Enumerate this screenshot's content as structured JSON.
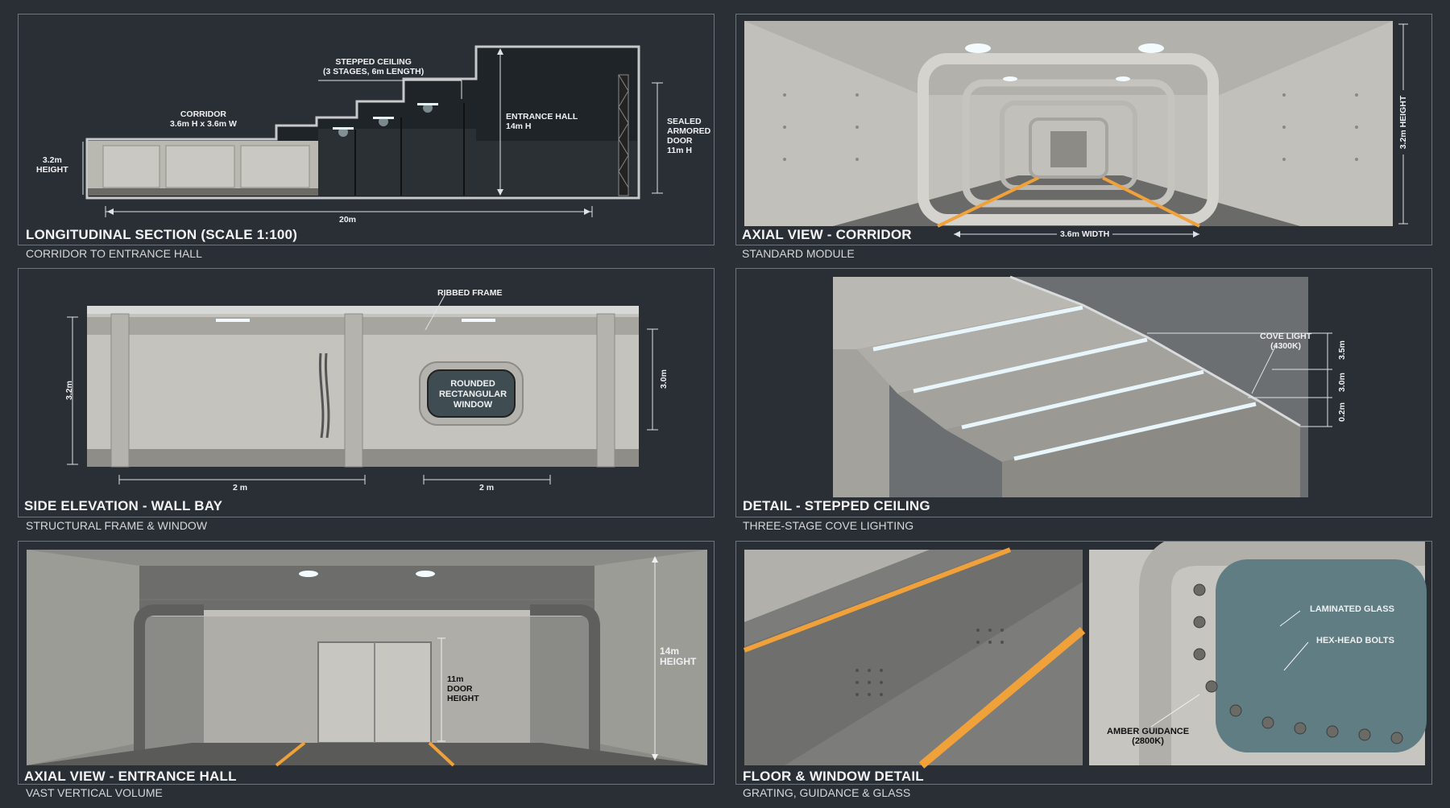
{
  "panels": {
    "section": {
      "title": "LONGITUDINAL SECTION (SCALE 1:100)",
      "subtitle": "CORRIDOR TO ENTRANCE HALL",
      "labels": {
        "corridor": "CORRIDOR",
        "corridor_dims": "3.6m H x 3.6m W",
        "height": "3.2m",
        "height2": "HEIGHT",
        "stepped": "STEPPED CEILING",
        "stepped_dims": "(3 STAGES, 6m LENGTH)",
        "hall": "ENTRANCE HALL",
        "hall_h": "14m H",
        "door1": "SEALED",
        "door2": "ARMORED",
        "door3": "DOOR",
        "door4": "11m H",
        "length": "20m"
      }
    },
    "corridor_view": {
      "title": "AXIAL VIEW - CORRIDOR",
      "subtitle": "STANDARD MODULE",
      "labels": {
        "width": "3.6m WIDTH",
        "height": "3.2m HEIGHT"
      }
    },
    "elevation": {
      "title": "SIDE ELEVATION - WALL BAY",
      "subtitle": "STRUCTURAL FRAME & WINDOW",
      "labels": {
        "frame": "RIBBED FRAME",
        "window1": "ROUNDED",
        "window2": "RECTANGULAR",
        "window3": "WINDOW",
        "h_left": "3.2m",
        "h_right": "3.0m",
        "bay1": "2 m",
        "bay2": "2 m"
      }
    },
    "ceiling": {
      "title": "DETAIL - STEPPED CEILING",
      "subtitle": "THREE-STAGE COVE LIGHTING",
      "labels": {
        "cove1": "COVE LIGHT",
        "cove2": "(4300K)",
        "d1": "3.5m",
        "d2": "3.0m",
        "d3": "0.2m"
      }
    },
    "hall_view": {
      "title": "AXIAL VIEW - ENTRANCE HALL",
      "subtitle": "VAST VERTICAL VOLUME",
      "labels": {
        "door1": "11m",
        "door2": "DOOR",
        "door3": "HEIGHT",
        "h1": "14m",
        "h2": "HEIGHT"
      }
    },
    "detail": {
      "title": "FLOOR & WINDOW DETAIL",
      "subtitle": "GRATING, GUIDANCE & GLASS",
      "labels": {
        "glass": "LAMINATED GLASS",
        "bolts": "HEX-HEAD BOLTS",
        "amber1": "AMBER GUIDANCE",
        "amber2": "(2800K)"
      }
    }
  },
  "colors": {
    "background": "#2a2f35",
    "panel_border": "#6d747b",
    "metal": "#c9c7c0",
    "amber": "#f0a13a"
  }
}
